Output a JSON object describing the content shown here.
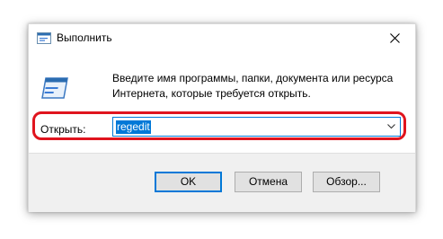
{
  "window": {
    "title": "Выполнить",
    "title_icon": "run-icon",
    "close_icon": "close-icon"
  },
  "main": {
    "icon": "run-large-icon",
    "description": "Введите имя программы, папки, документа или ресурса Интернета, которые требуется открыть.",
    "open_label": "Открыть:",
    "open_value": "regedit",
    "dropdown_icon": "chevron-down-icon"
  },
  "buttons": {
    "ok": "OK",
    "cancel": "Отмена",
    "browse": "Обзор..."
  },
  "colors": {
    "accent": "#0078d7",
    "highlight": "#e0141e",
    "footer_bg": "#f0f0f0",
    "button_bg": "#e1e1e1"
  }
}
